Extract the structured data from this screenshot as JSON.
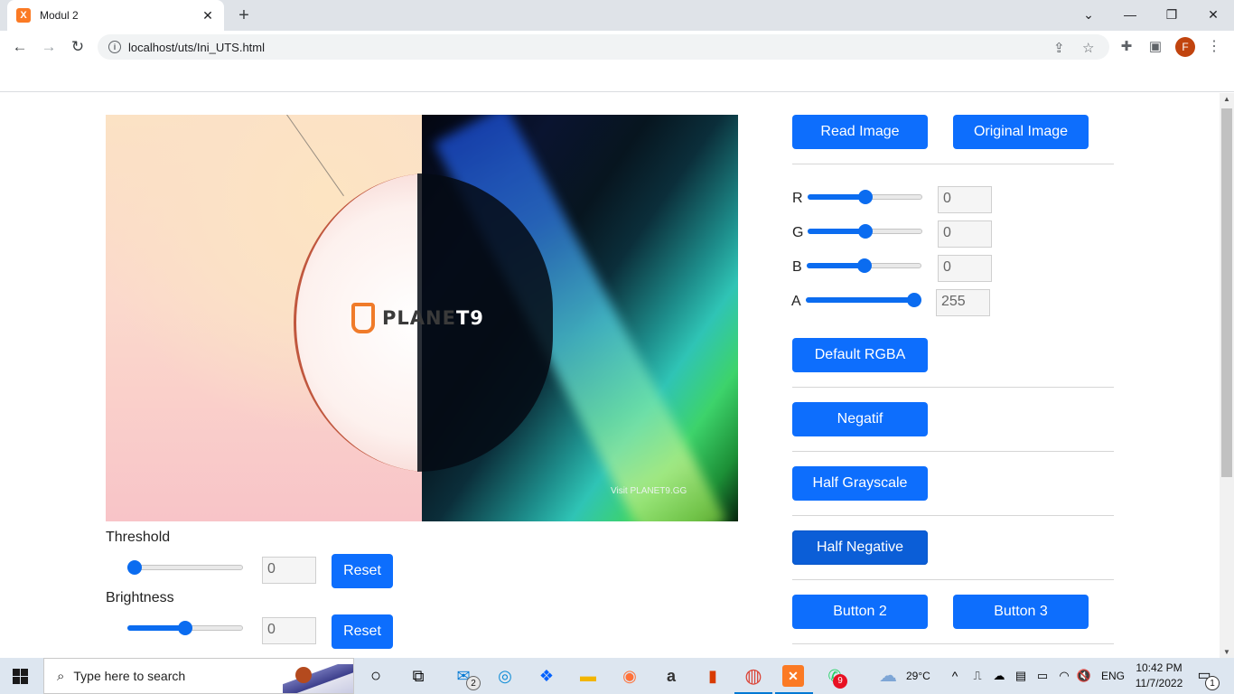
{
  "browser": {
    "tab_title": "Modul 2",
    "tab_favicon": "X",
    "url": "localhost/uts/Ini_UTS.html",
    "profile_initial": "F"
  },
  "image": {
    "logo_text_left": "PLANE",
    "logo_text_right": "T9",
    "visit_text": "Visit PLANET9.GG"
  },
  "threshold": {
    "label": "Threshold",
    "value": "0",
    "level": 0.0,
    "reset_label": "Reset"
  },
  "brightness": {
    "label": "Brightness",
    "value": "0",
    "level": 0.5,
    "reset_label": "Reset"
  },
  "panel": {
    "read_image": "Read Image",
    "original_image": "Original Image",
    "rgba": [
      {
        "label": "R",
        "value": "0",
        "level": 0.5
      },
      {
        "label": "G",
        "value": "0",
        "level": 0.5
      },
      {
        "label": "B",
        "value": "0",
        "level": 0.5
      },
      {
        "label": "A",
        "value": "255",
        "level": 1.0
      }
    ],
    "default_rgba": "Default RGBA",
    "negatif": "Negatif",
    "half_grayscale": "Half Grayscale",
    "half_negative": "Half Negative",
    "button2": "Button 2",
    "button3": "Button 3"
  },
  "taskbar": {
    "search_placeholder": "Type here to search",
    "mail_badge": "2",
    "whatsapp_badge": "9",
    "weather": "29°C",
    "language": "ENG",
    "time": "10:42 PM",
    "date": "11/7/2022",
    "notification_count": "1"
  },
  "colors": {
    "accent": "#0d6efd",
    "slider": "#0b6cf0"
  }
}
